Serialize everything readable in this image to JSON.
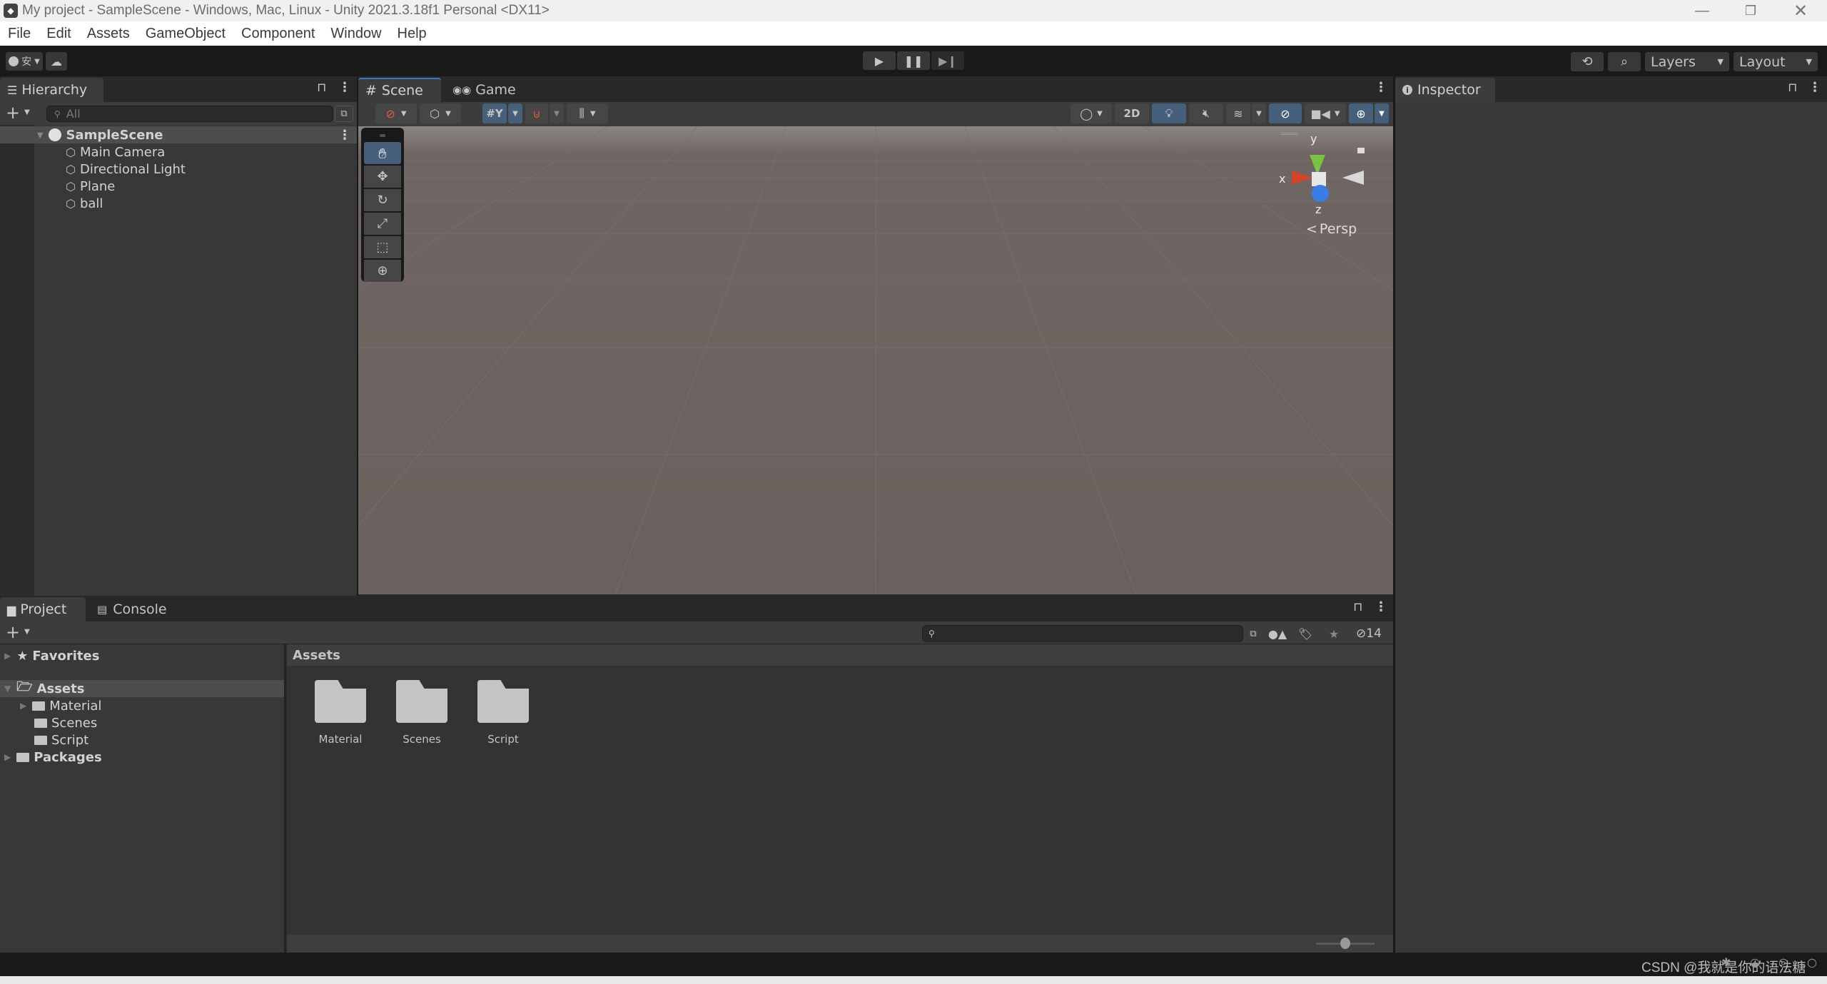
{
  "window": {
    "title": "My project - SampleScene - Windows, Mac, Linux - Unity 2021.3.18f1 Personal <DX11>",
    "controls": [
      "minimize",
      "restore",
      "close"
    ]
  },
  "menu": [
    "File",
    "Edit",
    "Assets",
    "GameObject",
    "Component",
    "Window",
    "Help"
  ],
  "toolbar": {
    "account_label": "安",
    "play_controls": [
      "play",
      "pause",
      "step"
    ],
    "layers_label": "Layers",
    "layout_label": "Layout"
  },
  "hierarchy": {
    "tab_label": "Hierarchy",
    "search_placeholder": "All",
    "scene": "SampleScene",
    "items": [
      "Main Camera",
      "Directional Light",
      "Plane",
      "ball"
    ]
  },
  "scene_view": {
    "tabs": [
      "Scene",
      "Game"
    ],
    "active_tab": "Scene",
    "toolbar_right": {
      "mode_2d": "2D"
    },
    "tools": [
      "hand",
      "move",
      "rotate",
      "scale",
      "rect",
      "transform"
    ],
    "active_tool": "hand",
    "gizmo": {
      "x": "x",
      "y": "y",
      "z": "z",
      "projection": "Persp"
    }
  },
  "inspector": {
    "tab_label": "Inspector"
  },
  "project": {
    "tabs": [
      "Project",
      "Console"
    ],
    "active_tab": "Project",
    "tree": {
      "favorites": "Favorites",
      "assets": "Assets",
      "asset_folders": [
        "Material",
        "Scenes",
        "Script"
      ],
      "packages": "Packages"
    },
    "breadcrumb": "Assets",
    "grid_items": [
      "Material",
      "Scenes",
      "Script"
    ],
    "hidden_count": "14",
    "zoom_slider": 0.5
  },
  "status": {
    "watermark": "CSDN @我就是你的语法糖️"
  }
}
